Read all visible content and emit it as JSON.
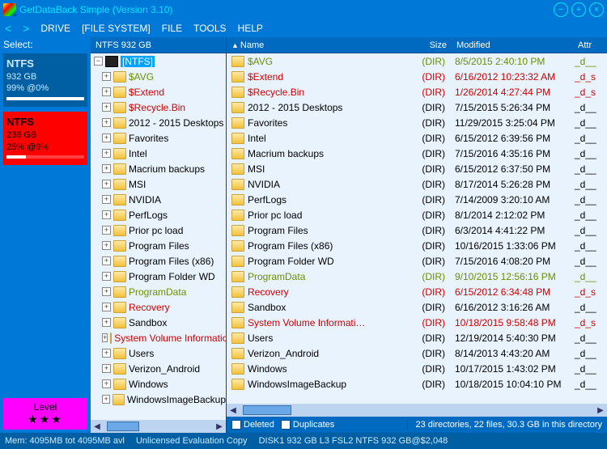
{
  "title": "GetDataBack Simple (Version 3.10)",
  "menu": {
    "drive": "DRIVE",
    "fs": "[FILE SYSTEM]",
    "file": "FILE",
    "tools": "TOOLS",
    "help": "HELP"
  },
  "nav": {
    "back": "<",
    "fwd": ">"
  },
  "winbtn": {
    "min": "−",
    "max": "+",
    "close": "×"
  },
  "sidebar": {
    "select": "Select:",
    "vols": [
      {
        "fs": "NTFS",
        "size": "932 GB",
        "pct": "99% @0%",
        "cls": "vol-blue"
      },
      {
        "fs": "NTFS",
        "size": "238 GB",
        "pct": "25% @9%",
        "cls": "vol-red red"
      }
    ],
    "level": {
      "label": "Level",
      "stars": "★★★"
    }
  },
  "tree": {
    "header": "NTFS 932 GB",
    "root": {
      "label": "[NTFS]"
    },
    "items": [
      {
        "label": "$AVG",
        "cls": "green"
      },
      {
        "label": "$Extend",
        "cls": "red"
      },
      {
        "label": "$Recycle.Bin",
        "cls": "red"
      },
      {
        "label": "2012 - 2015 Desktops",
        "cls": ""
      },
      {
        "label": "Favorites",
        "cls": ""
      },
      {
        "label": "Intel",
        "cls": ""
      },
      {
        "label": "Macrium backups",
        "cls": ""
      },
      {
        "label": "MSI",
        "cls": ""
      },
      {
        "label": "NVIDIA",
        "cls": ""
      },
      {
        "label": "PerfLogs",
        "cls": ""
      },
      {
        "label": "Prior pc load",
        "cls": ""
      },
      {
        "label": "Program Files",
        "cls": ""
      },
      {
        "label": "Program Files (x86)",
        "cls": ""
      },
      {
        "label": "Program Folder WD",
        "cls": ""
      },
      {
        "label": "ProgramData",
        "cls": "green"
      },
      {
        "label": "Recovery",
        "cls": "red"
      },
      {
        "label": "Sandbox",
        "cls": ""
      },
      {
        "label": "System Volume Information",
        "cls": "red"
      },
      {
        "label": "Users",
        "cls": ""
      },
      {
        "label": "Verizon_Android",
        "cls": ""
      },
      {
        "label": "Windows",
        "cls": ""
      },
      {
        "label": "WindowsImageBackup",
        "cls": ""
      }
    ]
  },
  "list": {
    "headers": {
      "name": "Name",
      "size": "Size",
      "mod": "Modified",
      "attr": "Attr"
    },
    "rows": [
      {
        "name": "$AVG",
        "size": "(DIR)",
        "mod": "8/5/2015 2:40:10 PM",
        "attr": "_d__",
        "cls": "green"
      },
      {
        "name": "$Extend",
        "size": "(DIR)",
        "mod": "6/16/2012 10:23:32 AM",
        "attr": "_d_s",
        "cls": "red"
      },
      {
        "name": "$Recycle.Bin",
        "size": "(DIR)",
        "mod": "1/26/2014 4:27:44 PM",
        "attr": "_d_s",
        "cls": "red"
      },
      {
        "name": "2012 - 2015 Desktops",
        "size": "(DIR)",
        "mod": "7/15/2015 5:26:34 PM",
        "attr": "_d__",
        "cls": ""
      },
      {
        "name": "Favorites",
        "size": "(DIR)",
        "mod": "11/29/2015 3:25:04 PM",
        "attr": "_d__",
        "cls": ""
      },
      {
        "name": "Intel",
        "size": "(DIR)",
        "mod": "6/15/2012 6:39:56 PM",
        "attr": "_d__",
        "cls": ""
      },
      {
        "name": "Macrium backups",
        "size": "(DIR)",
        "mod": "7/15/2016 4:35:16 PM",
        "attr": "_d__",
        "cls": ""
      },
      {
        "name": "MSI",
        "size": "(DIR)",
        "mod": "6/15/2012 6:37:50 PM",
        "attr": "_d__",
        "cls": ""
      },
      {
        "name": "NVIDIA",
        "size": "(DIR)",
        "mod": "8/17/2014 5:26:28 PM",
        "attr": "_d__",
        "cls": ""
      },
      {
        "name": "PerfLogs",
        "size": "(DIR)",
        "mod": "7/14/2009 3:20:10 AM",
        "attr": "_d__",
        "cls": ""
      },
      {
        "name": "Prior pc load",
        "size": "(DIR)",
        "mod": "8/1/2014 2:12:02 PM",
        "attr": "_d__",
        "cls": ""
      },
      {
        "name": "Program Files",
        "size": "(DIR)",
        "mod": "6/3/2014 4:41:22 PM",
        "attr": "_d__",
        "cls": ""
      },
      {
        "name": "Program Files (x86)",
        "size": "(DIR)",
        "mod": "10/16/2015 1:33:06 PM",
        "attr": "_d__",
        "cls": ""
      },
      {
        "name": "Program Folder WD",
        "size": "(DIR)",
        "mod": "7/15/2016 4:08:20 PM",
        "attr": "_d__",
        "cls": ""
      },
      {
        "name": "ProgramData",
        "size": "(DIR)",
        "mod": "9/10/2015 12:56:16 PM",
        "attr": "_d__",
        "cls": "green"
      },
      {
        "name": "Recovery",
        "size": "(DIR)",
        "mod": "6/15/2012 6:34:48 PM",
        "attr": "_d_s",
        "cls": "red"
      },
      {
        "name": "Sandbox",
        "size": "(DIR)",
        "mod": "6/16/2012 3:16:26 AM",
        "attr": "_d__",
        "cls": ""
      },
      {
        "name": "System Volume Informati…",
        "size": "(DIR)",
        "mod": "10/18/2015 9:58:48 PM",
        "attr": "_d_s",
        "cls": "red"
      },
      {
        "name": "Users",
        "size": "(DIR)",
        "mod": "12/19/2014 5:40:30 PM",
        "attr": "_d__",
        "cls": ""
      },
      {
        "name": "Verizon_Android",
        "size": "(DIR)",
        "mod": "8/14/2013 4:43:20 AM",
        "attr": "_d__",
        "cls": ""
      },
      {
        "name": "Windows",
        "size": "(DIR)",
        "mod": "10/17/2015 1:43:02 PM",
        "attr": "_d__",
        "cls": ""
      },
      {
        "name": "WindowsImageBackup",
        "size": "(DIR)",
        "mod": "10/18/2015 10:04:10 PM",
        "attr": "_d__",
        "cls": ""
      }
    ]
  },
  "filter": {
    "deleted": "Deleted",
    "dup": "Duplicates",
    "summary": "23 directories, 22 files, 30.3 GB in this directory"
  },
  "status": {
    "mem": "Mem: 4095MB tot 4095MB avl",
    "lic": "Unlicensed Evaluation Copy",
    "disk": "DISK1 932 GB L3 FSL2 NTFS 932 GB@$2,048"
  }
}
